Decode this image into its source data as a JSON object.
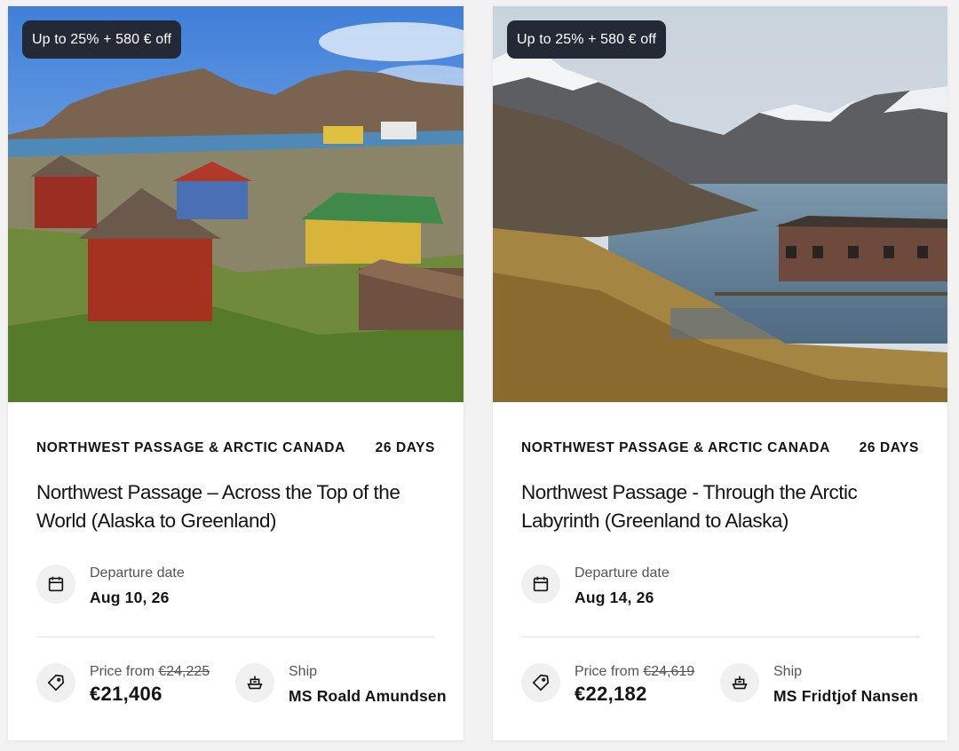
{
  "cards": [
    {
      "promo": "Up to 25% + 580 € off",
      "region": "NORTHWEST PASSAGE & ARCTIC CANADA",
      "duration": "26 DAYS",
      "title": "Northwest Passage – Across the Top of the World (Alaska to Greenland)",
      "departure_label": "Departure date",
      "departure_date": "Aug 10, 26",
      "price_label": "Price from",
      "old_price": "€24,225",
      "price": "€21,406",
      "ship_label": "Ship",
      "ship_name": "MS Roald Amundsen",
      "image_icon": "greenland-village-photo"
    },
    {
      "promo": "Up to 25% + 580 € off",
      "region": "NORTHWEST PASSAGE & ARCTIC CANADA",
      "duration": "26 DAYS",
      "title": "Northwest Passage - Through the Arctic Labyrinth (Greenland to Alaska)",
      "departure_label": "Departure date",
      "departure_date": "Aug 14, 26",
      "price_label": "Price from",
      "old_price": "€24,619",
      "price": "€22,182",
      "ship_label": "Ship",
      "ship_name": "MS Fridtjof Nansen",
      "image_icon": "arctic-fjord-photo"
    }
  ],
  "colors": {
    "badge_bg": "#232a35",
    "icon_circle_bg": "#f0f0f0",
    "page_bg": "#f2f2f2"
  }
}
